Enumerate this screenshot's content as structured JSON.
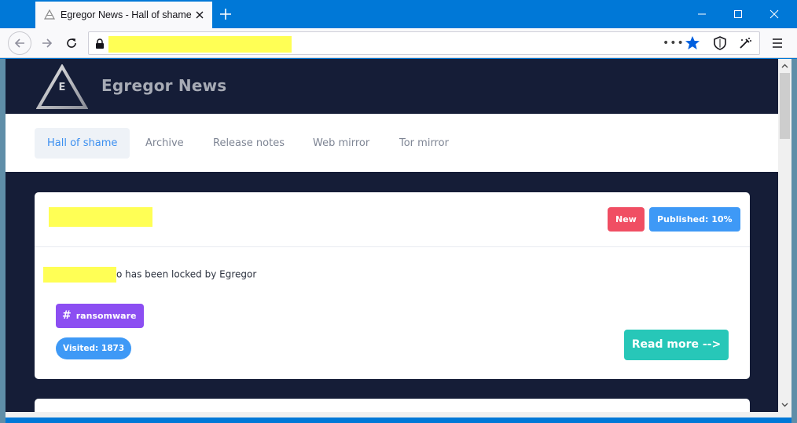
{
  "browser": {
    "tab_title": "Egregor News - Hall of shame",
    "url": "",
    "url_redacted": true,
    "icons": [
      "lock-icon",
      "more-dots-icon",
      "bookmark-star-icon",
      "shield-icon",
      "extensions-icon",
      "menu-icon"
    ],
    "colors": {
      "titlebar": "#0078d7",
      "bookmark_star": "#0060df"
    }
  },
  "site": {
    "brand": "Egregor News",
    "logo_letter": "E",
    "colors": {
      "header_bg": "#151d37"
    }
  },
  "nav": {
    "items": [
      {
        "label": "Hall of shame",
        "active": true
      },
      {
        "label": "Archive",
        "active": false
      },
      {
        "label": "Release notes",
        "active": false
      },
      {
        "label": "Web mirror",
        "active": false
      },
      {
        "label": "Tor mirror",
        "active": false
      }
    ]
  },
  "posts": [
    {
      "title": "",
      "title_redacted": true,
      "badge_new": "New",
      "badge_published": "Published: 10%",
      "description_suffix": "o has been locked by Egregor",
      "tag": "ransomware",
      "visited": "Visited: 1873",
      "read_more": "Read more -->",
      "colors": {
        "new": "#f04e63",
        "published": "#3e99f6",
        "tag": "#8c4ef2",
        "read_more": "#27c7b8"
      }
    }
  ]
}
